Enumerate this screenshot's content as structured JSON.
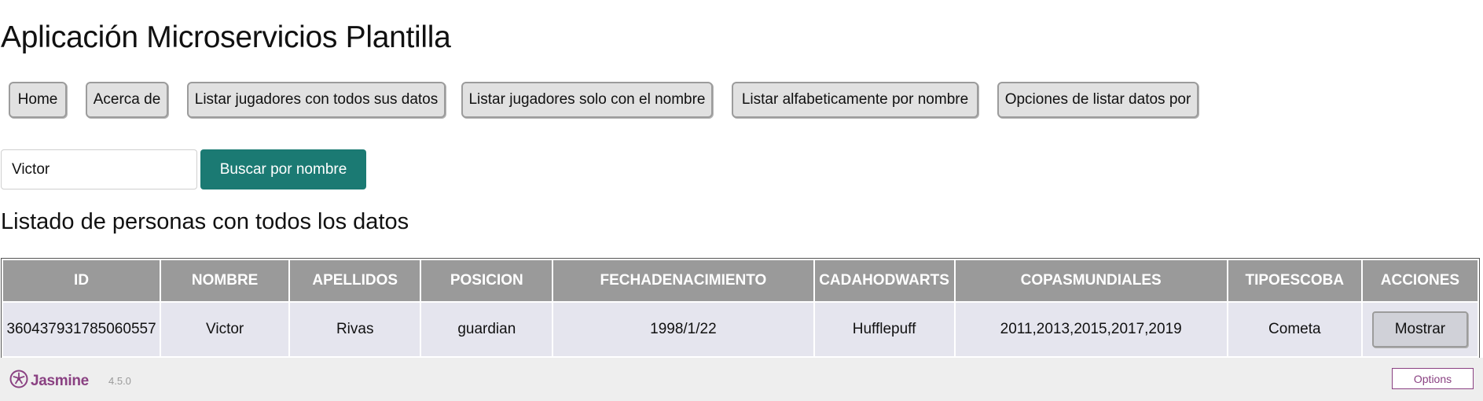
{
  "app": {
    "title": "Aplicación Microservicios Plantilla"
  },
  "nav": {
    "items": [
      {
        "label": "Home"
      },
      {
        "label": "Acerca de"
      },
      {
        "label": "Listar jugadores con todos sus datos"
      },
      {
        "label": "Listar jugadores solo con el nombre"
      },
      {
        "label": "Listar alfabeticamente por nombre"
      },
      {
        "label": "Opciones de listar datos por"
      }
    ]
  },
  "search": {
    "value": "Victor",
    "button_label": "Buscar por nombre"
  },
  "listing": {
    "title": "Listado de personas con todos los datos",
    "columns": [
      "ID",
      "NOMBRE",
      "APELLIDOS",
      "POSICION",
      "FECHADENACIMIENTO",
      "CADAHODWARTS",
      "COPASMUNDIALES",
      "TIPOESCOBA",
      "ACCIONES"
    ],
    "rows": [
      {
        "id": "360437931785060557",
        "nombre": "Victor",
        "apellidos": "Rivas",
        "posicion": "guardian",
        "fecha": "1998/1/22",
        "casa": "Hufflepuff",
        "copas": "2011,2013,2015,2017,2019",
        "escoba": "Cometa",
        "action_label": "Mostrar"
      }
    ]
  },
  "footer": {
    "brand": "Jasmine",
    "version": "4.5.0",
    "options_label": "Options",
    "brand_color": "#8a4182",
    "icon": "jasmine-flower-icon"
  },
  "colors": {
    "accent": "#1b7a73",
    "table_header": "#9a9a9a",
    "table_row": "#e5e5ee",
    "nav_button": "#e1e1e1"
  }
}
